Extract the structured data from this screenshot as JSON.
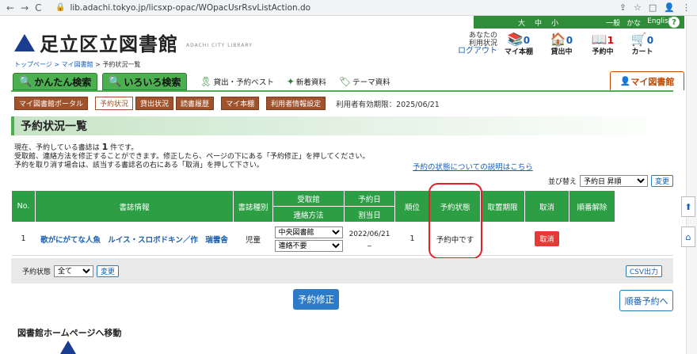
{
  "browser": {
    "url": "lib.adachi.tokyo.jp/licsxp-opac/WOpacUsrRsvListAction.do",
    "back": "←",
    "forward": "→",
    "reload": "C",
    "lock": "🔒",
    "tools": [
      "⇪",
      "☆",
      "□",
      "👤",
      "⋮"
    ]
  },
  "topbar": {
    "size_label_large": "大",
    "size_label_mid": "中",
    "size_label_small": "小",
    "general": "一般",
    "kana": "かな",
    "english": "English",
    "help": "?"
  },
  "logo": {
    "name": "足立区立図書館",
    "english": "ADACHI CITY LIBRARY"
  },
  "status": {
    "line1": "あなたの",
    "line2": "利用状況",
    "login": "ログアウト"
  },
  "header_icons": [
    {
      "label": "マイ本棚",
      "glyph": "📚",
      "count": "0"
    },
    {
      "label": "貸出中",
      "glyph": "🏠",
      "count": "0"
    },
    {
      "label": "予約中",
      "glyph": "📖",
      "count": "1"
    },
    {
      "label": "カート",
      "glyph": "🛒",
      "count": "0"
    }
  ],
  "breadcrumb": {
    "home": "トップページ",
    "mylib": "マイ図書館",
    "current": "予約状況一覧",
    "sep": " > "
  },
  "tabs": {
    "simple": "かんたん検索",
    "advanced": "いろいろ検索",
    "best": "貸出・予約ベスト",
    "new": "新着資料",
    "theme": "テーマ資料",
    "mylib": "マイ図書館"
  },
  "subnav": {
    "portal": "マイ図書館ポータル",
    "reservation": "予約状況",
    "lending": "貸出状況",
    "history": "読書履歴",
    "shelf": "マイ本棚",
    "userinfo": "利用者情報設定",
    "expiry": "利用者有効期限：2025/06/21"
  },
  "page_title": "予約状況一覧",
  "intro": {
    "line1_pre": "現在、予約している書誌は",
    "count": "1",
    "line1_post": "件です。",
    "line2": "受取館、連絡方法を修正することができます。修正したら、ページの下にある「予約修正」を押してください。",
    "line3": "予約を取り消す場合は、該当する書誌名の右にある「取消」を押して下さい。"
  },
  "help_link": "予約の状態についての説明はこちら",
  "sort": {
    "label": "並び替え",
    "value": "予約日 昇順",
    "button": "変更"
  },
  "table": {
    "headers": {
      "no": "No.",
      "info": "書誌情報",
      "type": "書誌種別",
      "pickup": "受取館",
      "contact": "連絡方法",
      "date": "予約日",
      "assigned": "割当日",
      "rank": "順位",
      "status": "予約状態",
      "deadline": "取置期限",
      "cancel": "取消",
      "queue": "順番解除"
    },
    "rows": [
      {
        "no": "1",
        "title": "歌がにがてな人魚　ルイス・スロボドキン／作　瑞雲舎",
        "type": "児童",
        "pickup": "中央図書館",
        "contact": "連絡不要",
        "date": "2022/06/21",
        "assigned": "_",
        "rank": "1",
        "status": "予約中です",
        "deadline": "",
        "cancel": "取消",
        "queue": ""
      }
    ]
  },
  "filter": {
    "label": "予約状態",
    "value": "全て",
    "button": "変更",
    "csv": "CSV出力"
  },
  "submit": "予約修正",
  "queue_button": "順番予約へ",
  "home_link": "図書館ホームページへ移動",
  "side": {
    "top": "⬆",
    "home": "⌂"
  }
}
